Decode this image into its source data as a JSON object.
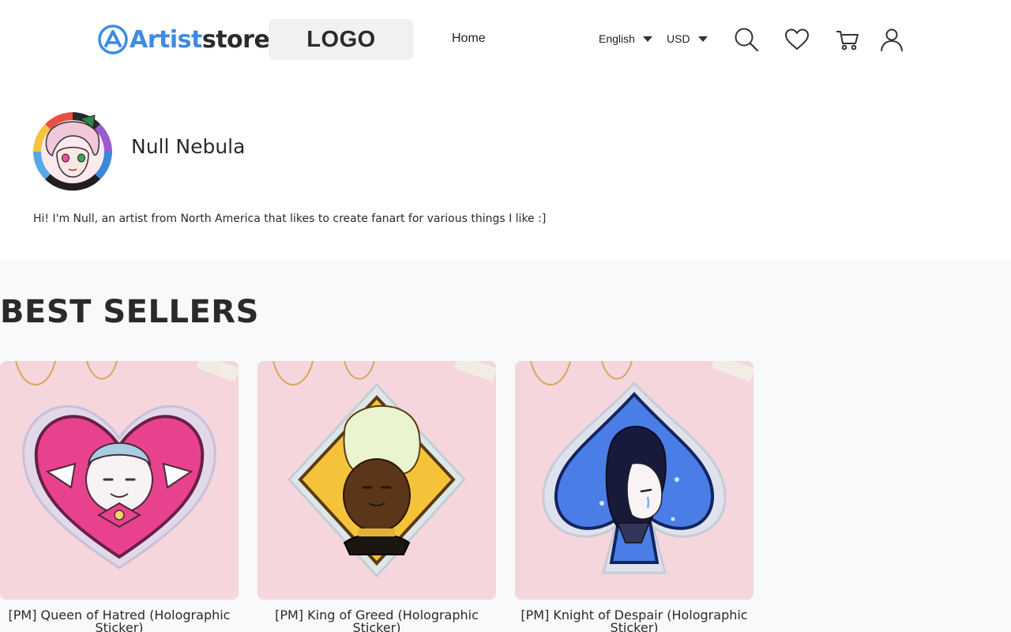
{
  "header": {
    "brand_prefix": "Artist",
    "brand_suffix": "store",
    "logo_placeholder": "LOGO",
    "nav_home": "Home",
    "language": "English",
    "currency": "USD",
    "icons": [
      "search-icon",
      "heart-icon",
      "cart-icon",
      "user-icon"
    ]
  },
  "profile": {
    "name": "Null Nebula",
    "bio": "Hi! I'm Null, an artist from North America that likes to create fanart for various things I like :]"
  },
  "best_sellers": {
    "title": "BEST SELLERS",
    "products": [
      {
        "name_line1": "[PM] Queen of Hatred (Holographic",
        "name_line2": "Sticker)"
      },
      {
        "name_line1": "[PM] King of Greed (Holographic",
        "name_line2": "Sticker)"
      },
      {
        "name_line1": "[PM] Knight of Despair (Holographic",
        "name_line2": "Sticker)"
      }
    ]
  },
  "colors": {
    "brand_blue": "#3e8be4",
    "sticker_bg": "#f4d6dc",
    "page_bg": "#f8f9fb"
  }
}
